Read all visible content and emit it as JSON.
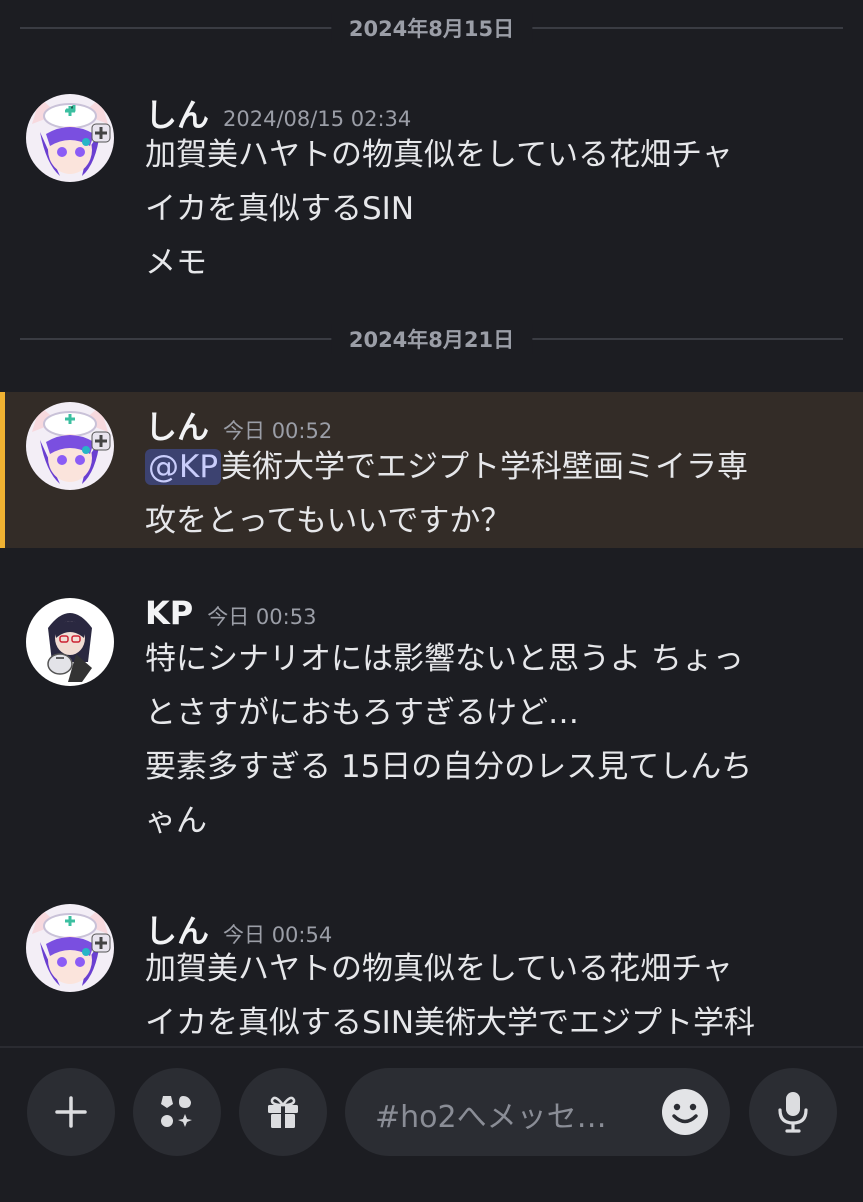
{
  "dividers": [
    "2024年8月15日",
    "2024年8月21日"
  ],
  "messages": [
    {
      "author": "しん",
      "timestamp": "2024/08/15 02:34",
      "lines": [
        "加賀美ハヤトの物真似をしている花畑チャ",
        "イカを真似するSIN",
        "メモ"
      ]
    },
    {
      "author": "しん",
      "timestamp": "今日 00:52",
      "mention": "@KP",
      "lines": [
        "美術大学でエジプト学科壁画ミイラ専",
        "攻をとってもいいですか？"
      ]
    },
    {
      "author": "KP",
      "timestamp": "今日 00:53",
      "lines": [
        "特にシナリオには影響ないと思うよ ちょっ",
        "とさすがにおもろすぎるけど…",
        "要素多すぎる 15日の自分のレス見てしんち",
        "ゃん"
      ]
    },
    {
      "author": "しん",
      "timestamp": "今日 00:54",
      "lines": [
        "加賀美ハヤトの物真似をしている花畑チャ",
        "イカを真似するSIN美術大学でエジプト学科"
      ]
    }
  ],
  "composer": {
    "placeholder": "#ho2へメッセ…",
    "icons": [
      "plus-icon",
      "apps-icon",
      "gift-icon",
      "emoji-icon",
      "microphone-icon"
    ]
  },
  "colors": {
    "background": "#1c1d22",
    "highlight_bg": "#332c27",
    "highlight_bar": "#f0b232",
    "mention_bg": "#3c4270"
  }
}
